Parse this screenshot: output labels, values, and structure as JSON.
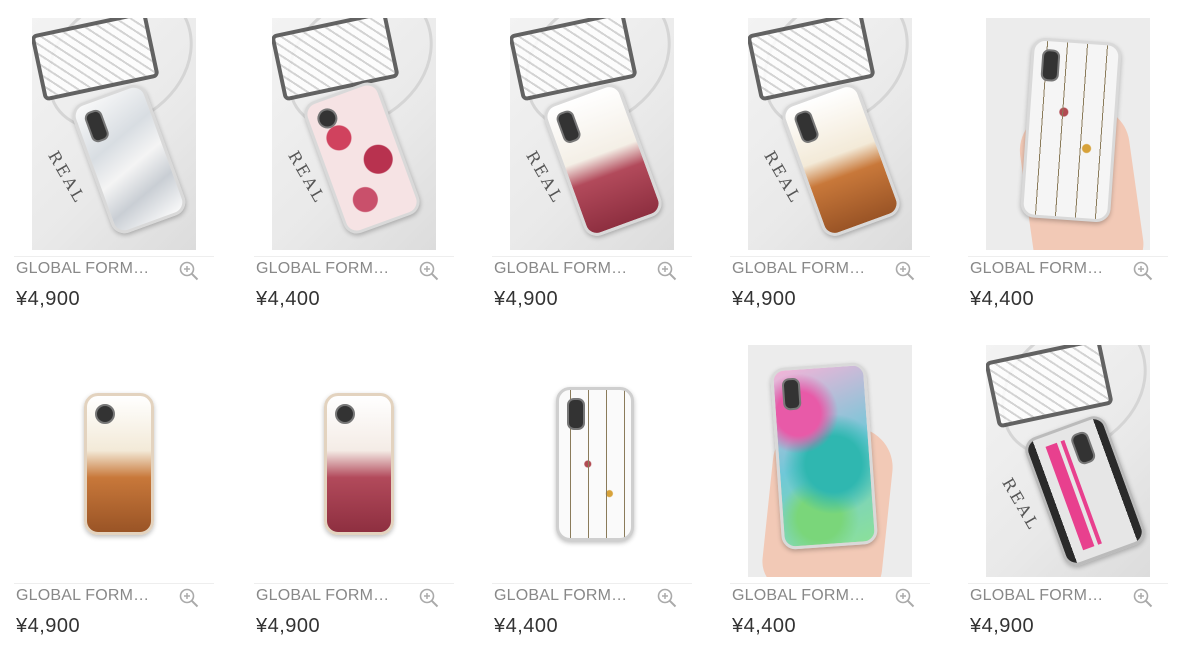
{
  "products": [
    {
      "name": "GLOBAL FORM…",
      "price": "¥4,900",
      "design": "marble"
    },
    {
      "name": "GLOBAL FORM…",
      "price": "¥4,400",
      "design": "floral-roses"
    },
    {
      "name": "GLOBAL FORM…",
      "price": "¥4,900",
      "design": "perfume-glitter-red"
    },
    {
      "name": "GLOBAL FORM…",
      "price": "¥4,900",
      "design": "perfume-glitter-gold"
    },
    {
      "name": "GLOBAL FORM…",
      "price": "¥4,400",
      "design": "pressed-flowers-in-hand"
    },
    {
      "name": "GLOBAL FORM…",
      "price": "¥4,900",
      "design": "perfume-glitter-gold"
    },
    {
      "name": "GLOBAL FORM…",
      "price": "¥4,900",
      "design": "perfume-glitter-red"
    },
    {
      "name": "GLOBAL FORM…",
      "price": "¥4,400",
      "design": "pressed-flowers"
    },
    {
      "name": "GLOBAL FORM…",
      "price": "¥4,400",
      "design": "watercolor-in-hand"
    },
    {
      "name": "GLOBAL FORM…",
      "price": "¥4,900",
      "design": "mix-tape"
    }
  ],
  "icons": {
    "zoom": "zoom-in-magnifier-icon"
  },
  "colors": {
    "name_text": "#888888",
    "price_text": "#333333",
    "zoom_icon": "#aaaaaa"
  }
}
